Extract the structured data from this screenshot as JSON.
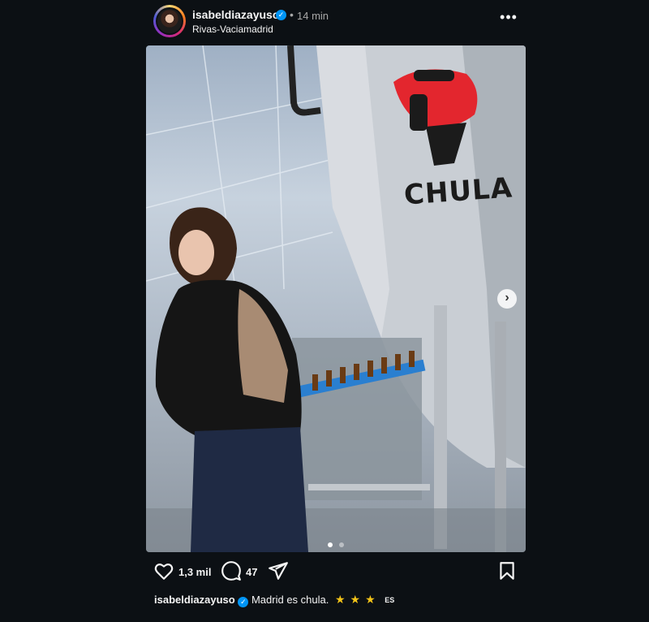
{
  "post": {
    "username": "isabeldiazayuso",
    "separator": "•",
    "time": "14 min",
    "location": "Rivas-Vaciamadrid",
    "more": "•••"
  },
  "photo": {
    "brand": "CHULA",
    "carousel_position": 1,
    "carousel_total": 2
  },
  "actions": {
    "likes": "1,3 mil",
    "comments": "47"
  },
  "caption": {
    "username": "isabeldiazayuso",
    "text": "Madrid es chula.",
    "stars": "★★★",
    "lang": "ES"
  },
  "icons": {
    "verified": "verified-badge-icon",
    "like": "heart-icon",
    "comment": "comment-bubble-icon",
    "share": "paper-plane-icon",
    "save": "bookmark-icon",
    "next": "chevron-right-icon"
  },
  "colors": {
    "background": "#0c1014",
    "verified": "#0095f6",
    "star": "#f5c518",
    "logo_red": "#e3262e"
  }
}
